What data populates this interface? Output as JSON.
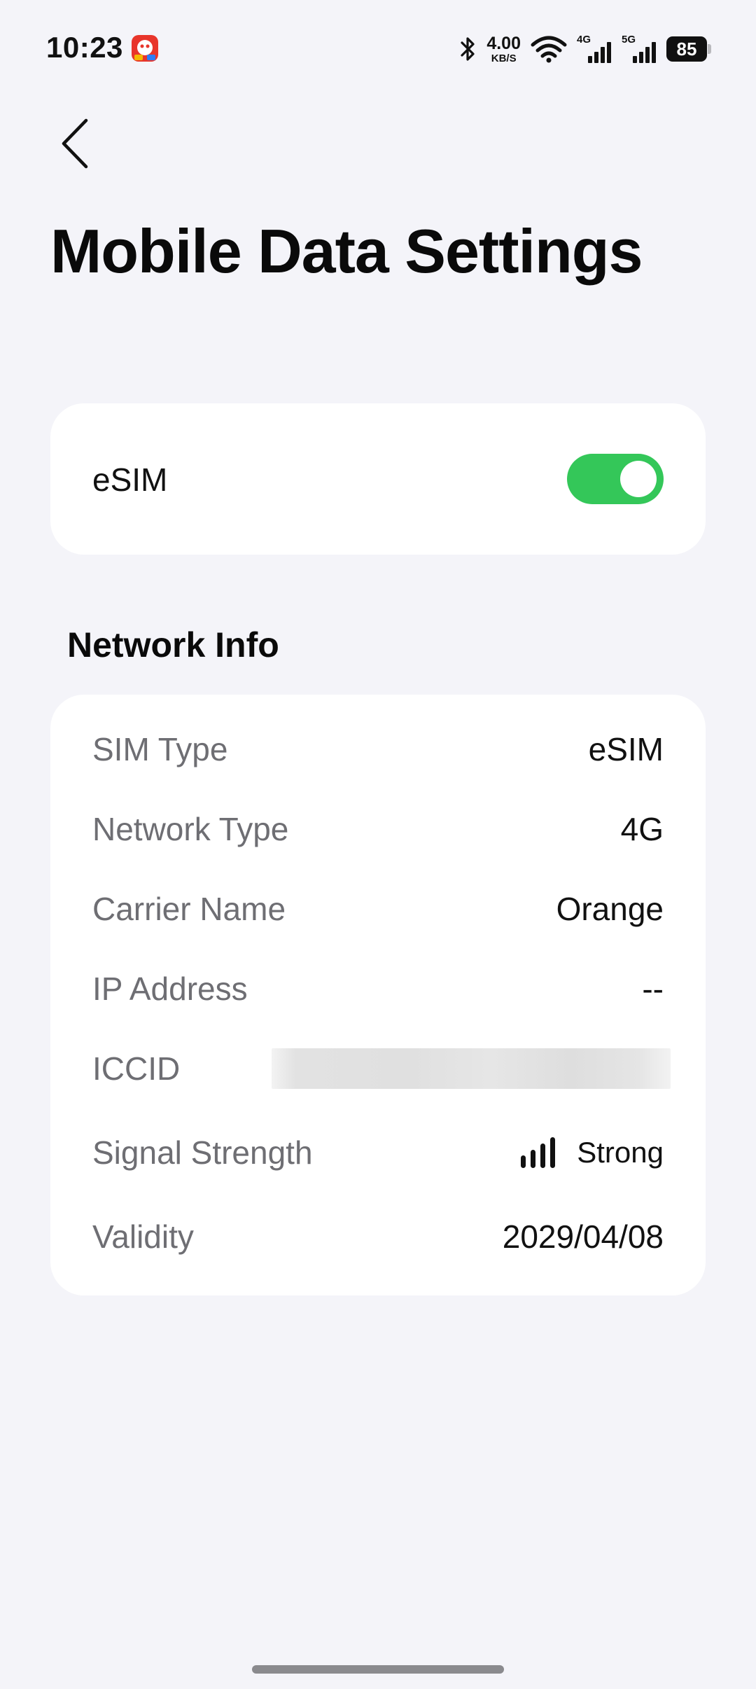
{
  "status_bar": {
    "time": "10:23",
    "app_notification_icon": "app-notification-icon",
    "network_speed": "4.00",
    "network_speed_unit": "KB/S",
    "cell_tag_1": "4G",
    "cell_tag_2": "5G",
    "battery_level": "85",
    "icons": [
      "bluetooth-icon",
      "wifi-icon",
      "cellular-signal-icon",
      "battery-icon"
    ]
  },
  "header": {
    "back_icon": "chevron-left-icon",
    "title": "Mobile Data Settings"
  },
  "esim_card": {
    "label": "eSIM",
    "toggle_on": true,
    "toggle_color": "#34c759"
  },
  "network_info": {
    "section_title": "Network Info",
    "rows": [
      {
        "label": "SIM Type",
        "value": "eSIM"
      },
      {
        "label": "Network Type",
        "value": "4G"
      },
      {
        "label": "Carrier Name",
        "value": "Orange"
      },
      {
        "label": "IP Address",
        "value": "--"
      },
      {
        "label": "ICCID",
        "value": ""
      },
      {
        "label": "Signal Strength",
        "value": "Strong",
        "icon": "signal-bars-icon"
      },
      {
        "label": "Validity",
        "value": "2029/04/08"
      }
    ]
  },
  "colors": {
    "background": "#f4f4f9",
    "card": "#ffffff",
    "accent_green": "#34c759",
    "label_gray": "#6e6e73"
  }
}
